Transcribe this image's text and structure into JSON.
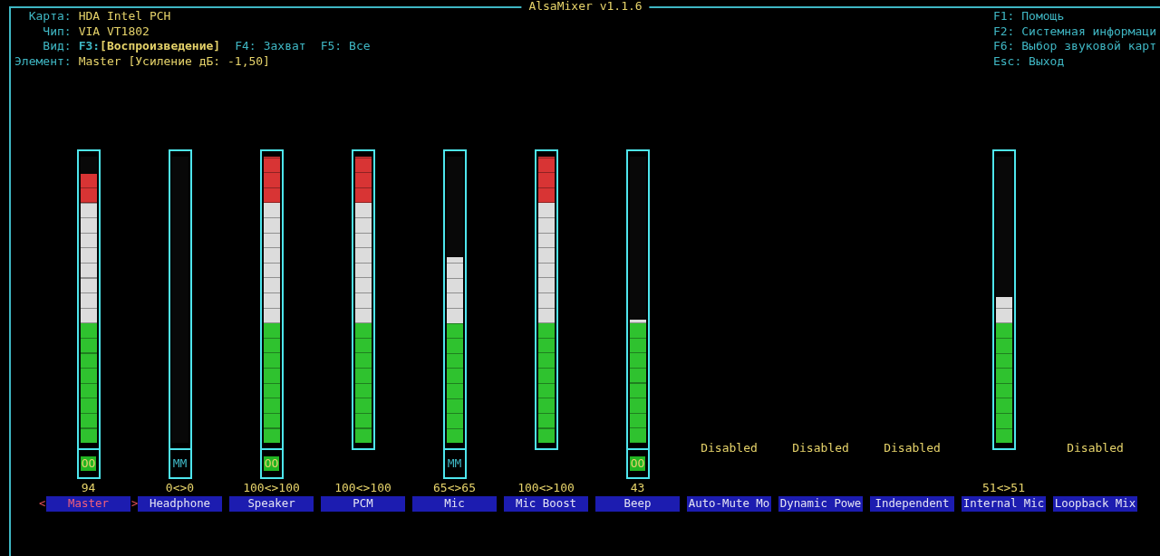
{
  "window": {
    "title": "AlsaMixer v1.1.6"
  },
  "info": [
    {
      "label": "Карта:",
      "value": "HDA Intel PCH"
    },
    {
      "label": "Чип:",
      "value": "VIA VT1802"
    }
  ],
  "view": {
    "label": "Вид:",
    "options": [
      {
        "key": "F3:",
        "name": "[Воспроизведение]",
        "selected": true
      },
      {
        "key": "F4:",
        "name": "Захват",
        "selected": false
      },
      {
        "key": "F5:",
        "name": "Все",
        "selected": false
      }
    ]
  },
  "element": {
    "label": "Элемент:",
    "value": "Master [Усиление дБ: -1,50]"
  },
  "help": [
    {
      "key": "F1:",
      "text": "Помощь"
    },
    {
      "key": "F2:",
      "text": "Системная информаци"
    },
    {
      "key": "F6:",
      "text": "Выбор звуковой карт"
    },
    {
      "key": "Esc:",
      "text": "Выход"
    }
  ],
  "selection_marks": {
    "left": "<",
    "right": ">"
  },
  "channels": [
    {
      "kind": "meter",
      "name": "Master",
      "selected": true,
      "level": 0.94,
      "value": "94",
      "switch": {
        "label": "OO",
        "muted": false
      }
    },
    {
      "kind": "meter",
      "name": "Headphone",
      "selected": false,
      "level": 0,
      "value": "0<>0",
      "switch": {
        "label": "MM",
        "muted": true
      }
    },
    {
      "kind": "meter",
      "name": "Speaker",
      "selected": false,
      "level": 1,
      "value": "100<>100",
      "switch": {
        "label": "OO",
        "muted": false
      }
    },
    {
      "kind": "meter",
      "name": "PCM",
      "selected": false,
      "level": 1,
      "value": "100<>100"
    },
    {
      "kind": "meter",
      "name": "Mic",
      "selected": false,
      "level": 0.65,
      "value": "65<>65",
      "switch": {
        "label": "MM",
        "muted": true
      }
    },
    {
      "kind": "meter",
      "name": "Mic Boost",
      "selected": false,
      "level": 1,
      "value": "100<>100"
    },
    {
      "kind": "meter",
      "name": "Beep",
      "selected": false,
      "level": 0.43,
      "value": "43",
      "switch": {
        "label": "OO",
        "muted": false
      }
    },
    {
      "kind": "disabled",
      "name": "Auto-Mute Mo",
      "selected": false,
      "status": "Disabled"
    },
    {
      "kind": "disabled",
      "name": "Dynamic Powe",
      "selected": false,
      "status": "Disabled"
    },
    {
      "kind": "disabled",
      "name": "Independent",
      "selected": false,
      "status": "Disabled"
    },
    {
      "kind": "meter",
      "name": "Internal Mic",
      "selected": false,
      "level": 0.51,
      "value": "51<>51"
    },
    {
      "kind": "disabled",
      "name": "Loopback Mix",
      "selected": false,
      "status": "Disabled"
    }
  ]
}
